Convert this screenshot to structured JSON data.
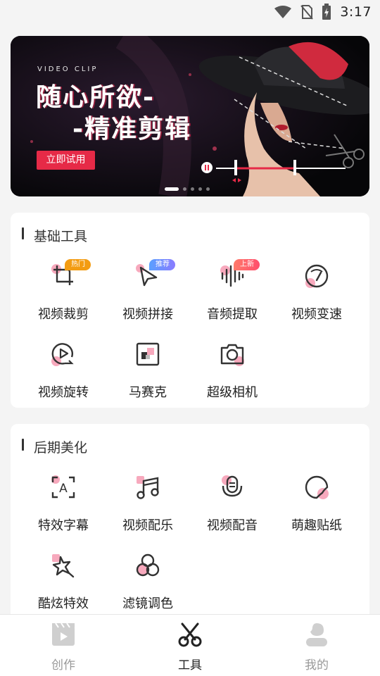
{
  "status_bar": {
    "time": "3:17"
  },
  "banner": {
    "eyebrow": "VIDEO CLIP",
    "headline_1": "随心所欲-",
    "headline_2": "-精准剪辑",
    "cta": "立即试用",
    "page_count": 5,
    "active_page": 1
  },
  "basic_tools": {
    "title": "基础工具",
    "items": [
      {
        "label": "视频裁剪",
        "icon": "crop-icon",
        "badge": "热门"
      },
      {
        "label": "视频拼接",
        "icon": "play-merge-icon",
        "badge": "推荐"
      },
      {
        "label": "音频提取",
        "icon": "waveform-icon",
        "badge": "上新"
      },
      {
        "label": "视频变速",
        "icon": "speedometer-icon"
      },
      {
        "label": "视频旋转",
        "icon": "rotate-play-icon"
      },
      {
        "label": "马赛克",
        "icon": "mosaic-icon"
      },
      {
        "label": "超级相机",
        "icon": "camera-icon"
      }
    ]
  },
  "post_tools": {
    "title": "后期美化",
    "items": [
      {
        "label": "特效字幕",
        "icon": "subtitle-icon"
      },
      {
        "label": "视频配乐",
        "icon": "music-note-icon"
      },
      {
        "label": "视频配音",
        "icon": "microphone-icon"
      },
      {
        "label": "萌趣贴纸",
        "icon": "sticker-icon"
      },
      {
        "label": "酷炫特效",
        "icon": "star-effect-icon"
      },
      {
        "label": "滤镜调色",
        "icon": "filter-icon"
      }
    ]
  },
  "tabbar": {
    "tabs": [
      {
        "label": "创作",
        "icon": "clapper-play-icon",
        "active": false
      },
      {
        "label": "工具",
        "icon": "scissors-icon",
        "active": true
      },
      {
        "label": "我的",
        "icon": "user-icon",
        "active": false
      }
    ]
  },
  "colors": {
    "accent": "#e62a47",
    "pink_spot": "#f7a9bd",
    "icon_stroke": "#333333"
  }
}
